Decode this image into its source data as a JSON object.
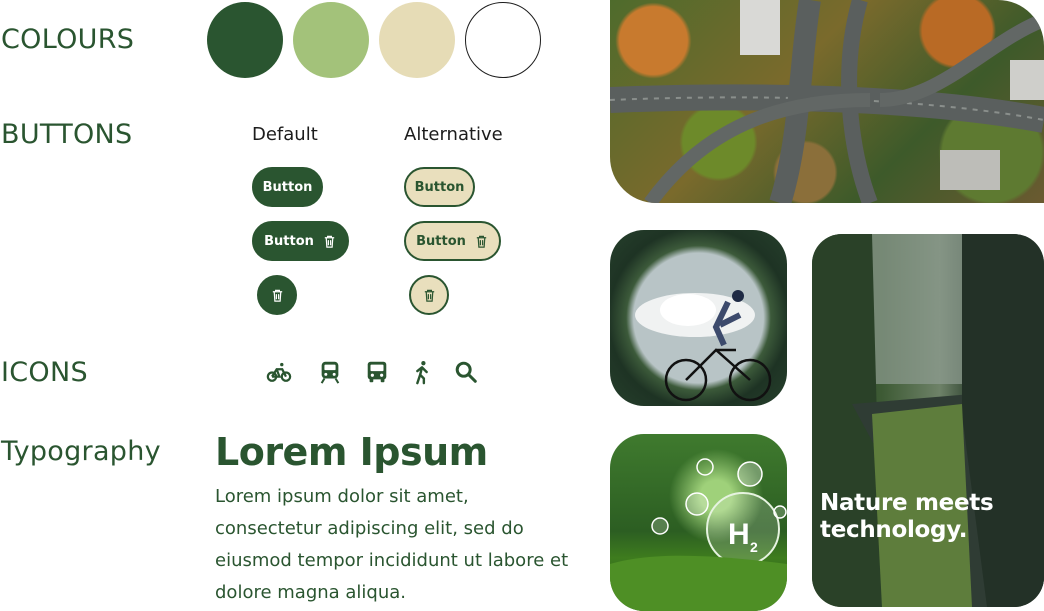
{
  "labels": {
    "colours": "COLOURS",
    "buttons": "BUTTONS",
    "icons": "ICONS",
    "typography": "Typography"
  },
  "colours": {
    "swatches": [
      "#2a5530",
      "#a3c27a",
      "#e6dcb6",
      "#ffffff"
    ]
  },
  "buttons": {
    "default_heading": "Default",
    "alternative_heading": "Alternative",
    "label": "Button"
  },
  "icons": [
    "bicycle-icon",
    "train-icon",
    "bus-icon",
    "walking-icon",
    "search-icon"
  ],
  "typography": {
    "heading": "Lorem Ipsum",
    "body": "Lorem ipsum dolor sit amet, consectetur adipiscing elit, sed do eiusmod tempor incididunt ut labore et dolore magna aliqua."
  },
  "images": {
    "train_caption_line1": "Nature meets",
    "train_caption_line2": "technology."
  }
}
